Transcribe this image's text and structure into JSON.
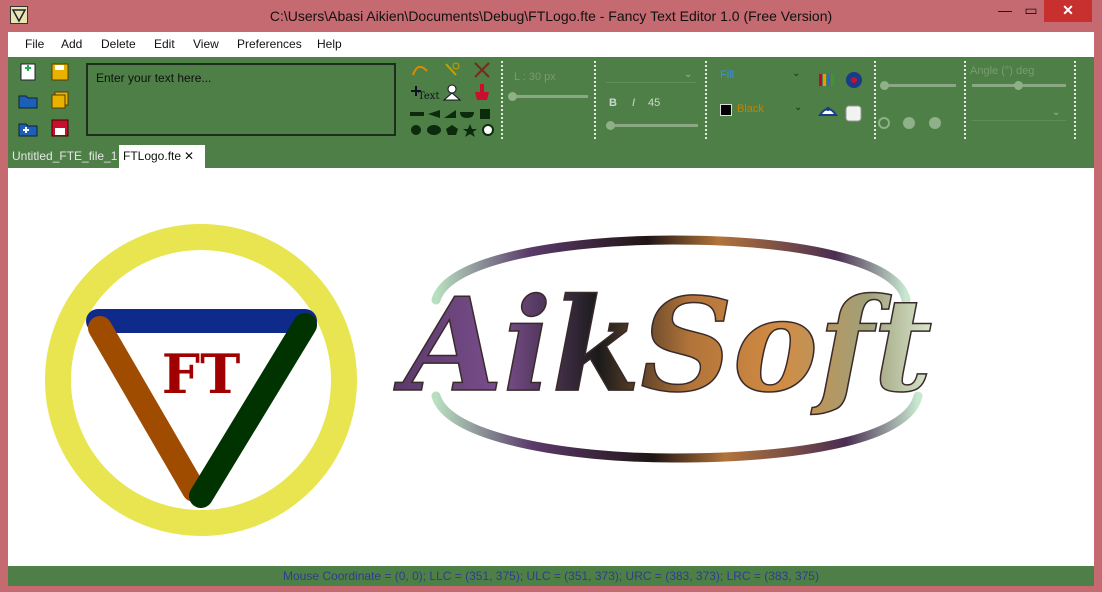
{
  "window": {
    "title": "C:\\Users\\Abasi Aikien\\Documents\\Debug\\FTLogo.fte - Fancy Text Editor 1.0 (Free Version)",
    "minimize_glyph": "—",
    "maximize_glyph": "▭",
    "close_glyph": "✕"
  },
  "menu": {
    "items": [
      "File",
      "Add",
      "Delete",
      "Edit",
      "View",
      "Preferences",
      "Help"
    ]
  },
  "toolbar": {
    "text_entry_placeholder": "Enter your text here...",
    "line_width_label": "L : 30 px",
    "bold_label": "B",
    "italic_label": "I",
    "angle_value": "45",
    "fill_mode": "Fill",
    "color_value": "Black",
    "angle_label": "Angle (°) deg",
    "text_icon_label": "Text"
  },
  "tabs": [
    {
      "label": "Untitled_FTE_file_1",
      "active": false
    },
    {
      "label": "FTLogo.fte",
      "active": true,
      "close_glyph": "✕"
    }
  ],
  "canvas": {
    "logo_letters": "FT",
    "wordmark": "AikSoft",
    "ring_color": "#e8e551",
    "triangle_top_color": "#0e2a8a",
    "triangle_left_color": "#a04c00",
    "triangle_right_color": "#003300",
    "letters_color": "#a00000"
  },
  "status": {
    "text": "Mouse Coordinate = (0, 0); LLC = (351, 375); ULC = (351, 373); URC = (383, 373); LRC = (383, 375)"
  },
  "colors": {
    "frame": "#c46a70",
    "toolbar": "#4d7f46",
    "status_text": "#2a3f8f"
  }
}
